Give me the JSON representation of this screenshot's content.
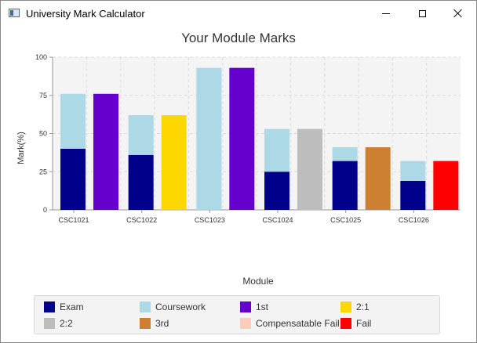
{
  "window": {
    "title": "University Mark Calculator",
    "icon": "window-app-icon",
    "controls": [
      "minimize-icon",
      "maximize-icon",
      "close-icon"
    ]
  },
  "colors": {
    "exam": "#00008b",
    "coursework": "#add8e6",
    "first": "#6600cc",
    "two_one": "#ffd700",
    "two_two": "#bdbdbd",
    "third": "#cd7f32",
    "compensatable_fail": "#ffccbb",
    "fail": "#ff0000",
    "grid": "#dcdcdc",
    "plot_bg": "#f4f4f4"
  },
  "chart_data": {
    "type": "bar",
    "title": "Your Module Marks",
    "xlabel": "Module",
    "ylabel": "Mark(%)",
    "ylim": [
      0,
      100
    ],
    "yticks": [
      0,
      25,
      50,
      75,
      100
    ],
    "categories": [
      "CSC1021",
      "CSC1022",
      "CSC1023",
      "CSC1024",
      "CSC1025",
      "CSC1026"
    ],
    "stacked_series": [
      {
        "name": "Exam",
        "values": [
          40,
          36,
          0,
          25,
          32,
          19
        ]
      },
      {
        "name": "Coursework",
        "values": [
          36,
          26,
          93,
          28,
          9,
          13
        ]
      }
    ],
    "classification_bars": [
      {
        "value": 76,
        "class": "1st"
      },
      {
        "value": 62,
        "class": "2:1"
      },
      {
        "value": 93,
        "class": "1st"
      },
      {
        "value": 53,
        "class": "2:2"
      },
      {
        "value": 41,
        "class": "3rd"
      },
      {
        "value": 32,
        "class": "Fail"
      }
    ],
    "legend_position": "bottom",
    "grid": true
  },
  "legend": {
    "items": [
      {
        "label": "Exam",
        "color": "#00008b"
      },
      {
        "label": "Coursework",
        "color": "#add8e6"
      },
      {
        "label": "1st",
        "color": "#6600cc"
      },
      {
        "label": "2:1",
        "color": "#ffd700"
      },
      {
        "label": "2:2",
        "color": "#bdbdbd"
      },
      {
        "label": "3rd",
        "color": "#cd7f32"
      },
      {
        "label": "Compensatable Fail",
        "color": "#ffccbb"
      },
      {
        "label": "Fail",
        "color": "#ff0000"
      }
    ]
  }
}
